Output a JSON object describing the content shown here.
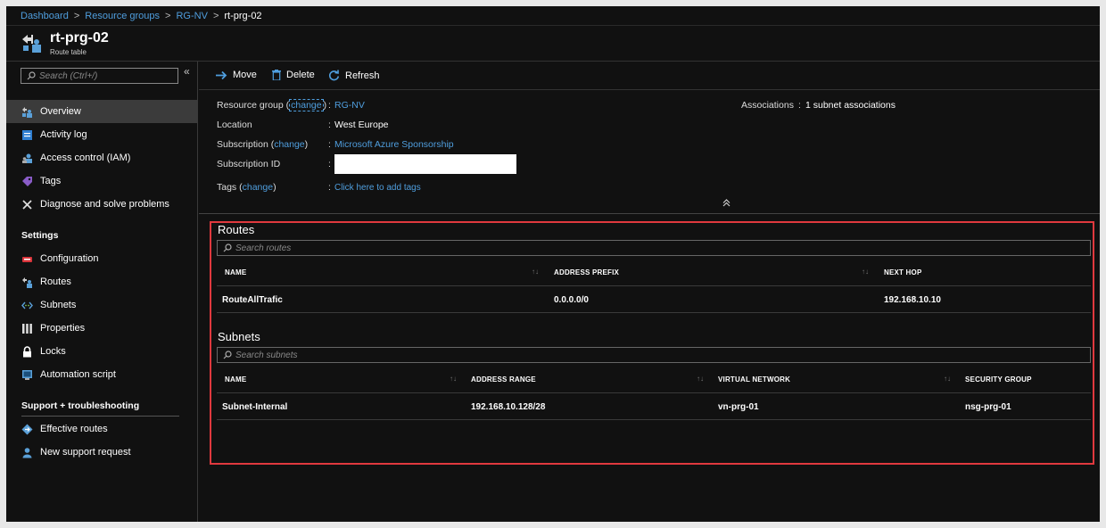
{
  "breadcrumb": {
    "items": [
      "Dashboard",
      "Resource groups",
      "RG-NV"
    ],
    "current": "rt-prg-02",
    "separator": ">"
  },
  "header": {
    "title": "rt-prg-02",
    "subtitle": "Route table"
  },
  "sidebar": {
    "search_placeholder": "Search (Ctrl+/)",
    "collapse_glyph": "«",
    "items_top": [
      {
        "label": "Overview",
        "icon": "route-table-icon"
      },
      {
        "label": "Activity log",
        "icon": "activity-log-icon"
      },
      {
        "label": "Access control (IAM)",
        "icon": "iam-icon"
      },
      {
        "label": "Tags",
        "icon": "tag-icon"
      },
      {
        "label": "Diagnose and solve problems",
        "icon": "wrench-icon"
      }
    ],
    "settings_header": "Settings",
    "items_settings": [
      {
        "label": "Configuration",
        "icon": "configuration-icon"
      },
      {
        "label": "Routes",
        "icon": "routes-icon"
      },
      {
        "label": "Subnets",
        "icon": "subnets-icon"
      },
      {
        "label": "Properties",
        "icon": "properties-icon"
      },
      {
        "label": "Locks",
        "icon": "lock-icon"
      },
      {
        "label": "Automation script",
        "icon": "automation-script-icon"
      }
    ],
    "support_header": "Support + troubleshooting",
    "items_support": [
      {
        "label": "Effective routes",
        "icon": "effective-routes-icon"
      },
      {
        "label": "New support request",
        "icon": "support-request-icon"
      }
    ]
  },
  "toolbar": {
    "move_label": "Move",
    "delete_label": "Delete",
    "refresh_label": "Refresh"
  },
  "essentials": {
    "resource_group_label": "Resource group",
    "resource_group_value": "RG-NV",
    "location_label": "Location",
    "location_value": "West Europe",
    "subscription_label": "Subscription",
    "subscription_value": "Microsoft Azure Sponsorship",
    "subscription_id_label": "Subscription ID",
    "tags_label": "Tags",
    "tags_value": "Click here to add tags",
    "change_text": "change",
    "open_paren": "(",
    "close_paren": ")",
    "colon": ":",
    "associations_label": "Associations",
    "associations_value": "1 subnet associations",
    "collapse_glyph": "⌃"
  },
  "routes": {
    "title": "Routes",
    "search_placeholder": "Search routes",
    "columns": [
      "NAME",
      "ADDRESS PREFIX",
      "NEXT HOP"
    ],
    "rows": [
      {
        "name": "RouteAllTrafic",
        "prefix": "0.0.0.0/0",
        "next_hop": "192.168.10.10"
      }
    ]
  },
  "subnets": {
    "title": "Subnets",
    "search_placeholder": "Search subnets",
    "columns": [
      "NAME",
      "ADDRESS RANGE",
      "VIRTUAL NETWORK",
      "SECURITY GROUP"
    ],
    "rows": [
      {
        "name": "Subnet-Internal",
        "range": "192.168.10.128/28",
        "vnet": "vn-prg-01",
        "nsg": "nsg-prg-01"
      }
    ]
  },
  "sort_glyph": "↑↓",
  "colors": {
    "accent_link": "#4f9ede",
    "highlight_border": "#e0393e",
    "background": "#111111",
    "active_nav": "#3b3b3b"
  }
}
